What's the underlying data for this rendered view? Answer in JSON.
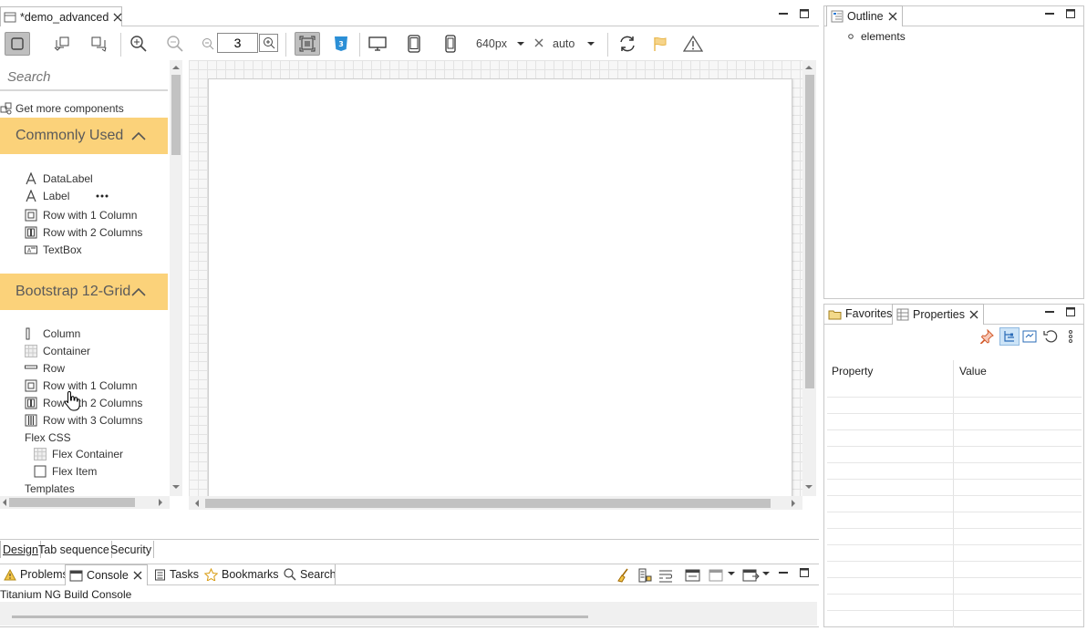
{
  "editor": {
    "tab_title": "*demo_advanced"
  },
  "toolbar": {
    "zoom_value": "3",
    "width_value": "640px",
    "height_value": "auto"
  },
  "palette": {
    "search_placeholder": "Search",
    "get_more": "Get more components",
    "groups": [
      {
        "title": "Commonly Used",
        "items": [
          "DataLabel",
          "Label",
          "Row with 1 Column",
          "Row with 2 Columns",
          "TextBox"
        ]
      },
      {
        "title": "Bootstrap 12-Grid",
        "items": [
          "Column",
          "Container",
          "Row",
          "Row with 1 Column",
          "Row with 2 Columns",
          "Row with 3 Columns"
        ]
      }
    ],
    "flex_css": "Flex CSS",
    "flex_items": [
      "Flex Container",
      "Flex Item"
    ],
    "templates": "Templates"
  },
  "editor_tabs": [
    "Design",
    "Tab sequence",
    "Security"
  ],
  "console": {
    "tabs": [
      "Problems",
      "Console",
      "Tasks",
      "Bookmarks",
      "Search"
    ],
    "text": "Titanium NG Build Console"
  },
  "outline": {
    "title": "Outline",
    "item": "elements"
  },
  "props": {
    "tabs": [
      "Favorites",
      "Properties"
    ],
    "col_property": "Property",
    "col_value": "Value"
  }
}
